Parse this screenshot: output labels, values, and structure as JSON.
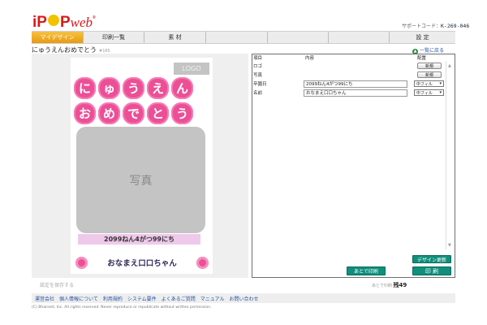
{
  "header": {
    "logo_text": "iP",
    "logo_p": "P",
    "logo_web": "web",
    "logo_mark": "®",
    "support_label": "サポートコード：",
    "support_code": "K-269-046"
  },
  "tabs": [
    {
      "label": "マイデザイン",
      "active": true
    },
    {
      "label": "印刷一覧",
      "active": false
    },
    {
      "label": "素 材",
      "active": false
    },
    {
      "label": "",
      "active": false
    },
    {
      "label": "",
      "active": false
    },
    {
      "label": "",
      "active": false
    },
    {
      "label": "設 定",
      "active": false
    }
  ],
  "page": {
    "title": "にゅうえんおめでとう",
    "title_sub": "#165",
    "back_label": "一覧に戻る"
  },
  "preview": {
    "logo_placeholder": "LOGO",
    "row1": [
      "に",
      "ゅ",
      "う",
      "え",
      "ん"
    ],
    "row2": [
      "お",
      "め",
      "で",
      "と",
      "う"
    ],
    "photo_label": "写真",
    "date_text": "2099ねん4がつ99にち",
    "name_text": "おなまえ口口ちゃん"
  },
  "panel": {
    "col_item": "項目",
    "col_content": "内容",
    "col_layout": "配置",
    "rows": [
      {
        "label": "ロゴ",
        "value": "",
        "action": "新規"
      },
      {
        "label": "写真",
        "value": "",
        "action": "新規"
      },
      {
        "label": "卒園日",
        "value": "2099ねん4がつ99にち",
        "action": "中フィル"
      },
      {
        "label": "名前",
        "value": "おなまえ口口ちゃん",
        "action": "中フィル"
      }
    ],
    "design_update": "デザイン更新",
    "save_later": "あとで印刷",
    "print": "印 刷"
  },
  "bottom": {
    "save_label": "設定を保存する",
    "remaining_label": "あとで印刷",
    "remaining_value": "残49"
  },
  "footer": {
    "links": [
      "運営会社",
      "個人情報について",
      "利用規約",
      "システム要件",
      "よくあるご質問",
      "マニュアル",
      "お問い合わせ"
    ],
    "copyright": "(C) Bhaireet, Inc. All rights reserved. Never reproduce or republicate without written permission."
  },
  "colors": {
    "accent_tab": "#e79b10",
    "pink": "#ec4f96",
    "button_green": "#0f8f7c",
    "link_blue": "#2753a4"
  }
}
